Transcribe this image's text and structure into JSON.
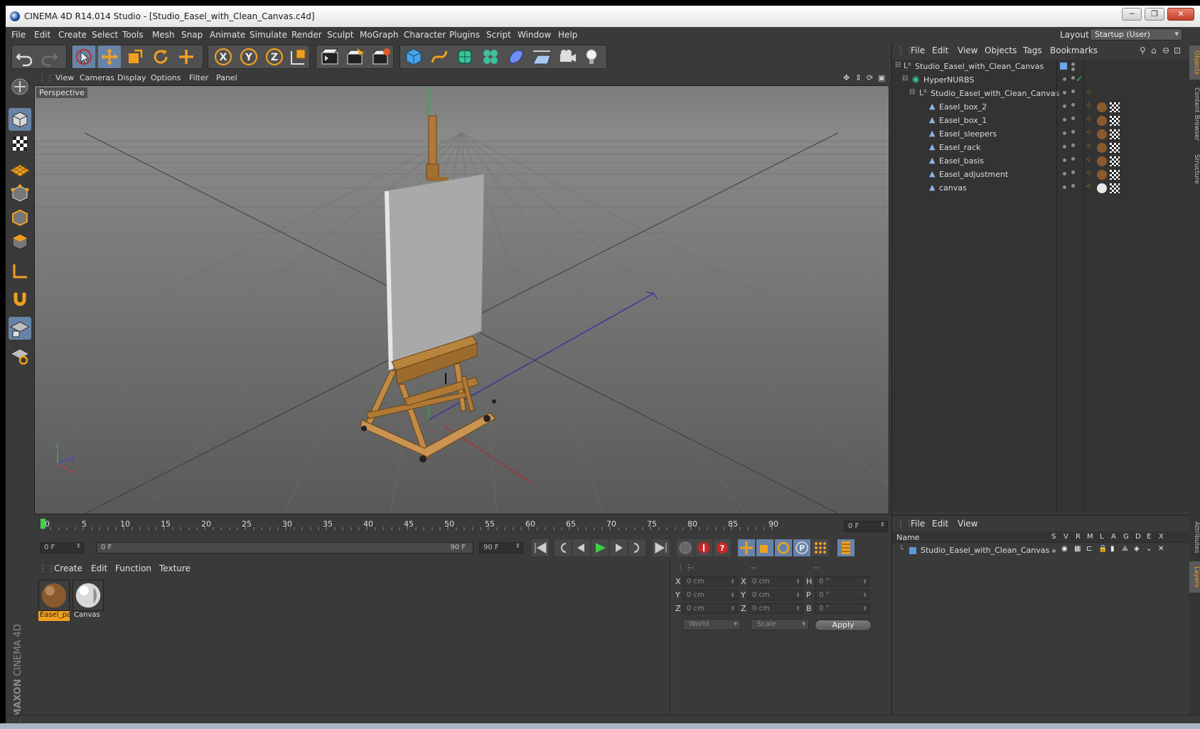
{
  "window": {
    "title": "CINEMA 4D R14.014 Studio - [Studio_Easel_with_Clean_Canvas.c4d]",
    "min": "─",
    "max": "❐",
    "close": "✕"
  },
  "menubar": {
    "items": [
      "File",
      "Edit",
      "Create",
      "Select",
      "Tools",
      "Mesh",
      "Snap",
      "Animate",
      "Simulate",
      "Render",
      "Sculpt",
      "MoGraph",
      "Character",
      "Plugins",
      "Script",
      "Window",
      "Help"
    ],
    "layout_label": "Layout:",
    "layout_value": "Startup (User)"
  },
  "viewport": {
    "menu": [
      "View",
      "Cameras",
      "Display",
      "Options",
      "Filter",
      "Panel"
    ],
    "label": "Perspective",
    "axis_y": "Y",
    "axis_x": "X",
    "axis_z": "Z"
  },
  "timeline": {
    "ticks": [
      "0",
      "5",
      "10",
      "15",
      "20",
      "25",
      "30",
      "35",
      "40",
      "45",
      "50",
      "55",
      "60",
      "65",
      "70",
      "75",
      "80",
      "85",
      "90"
    ],
    "current_frame": "0 F",
    "start_frame": "0 F",
    "range_start": "0 F",
    "range_end": "90 F",
    "end_frame": "90 F"
  },
  "material_manager": {
    "menu": [
      "Create",
      "Edit",
      "Function",
      "Texture"
    ],
    "materials": [
      {
        "label": "Easel_pa",
        "selected": true
      },
      {
        "label": "Canvas",
        "selected": false
      }
    ]
  },
  "coordinates": {
    "col_headers": [
      "--",
      "--",
      "--"
    ],
    "rows": [
      {
        "pos_label": "X",
        "pos_value": "0 cm",
        "size_label": "X",
        "size_value": "0 cm",
        "rot_label": "H",
        "rot_value": "0 °"
      },
      {
        "pos_label": "Y",
        "pos_value": "0 cm",
        "size_label": "Y",
        "size_value": "0 cm",
        "rot_label": "P",
        "rot_value": "0 °"
      },
      {
        "pos_label": "Z",
        "pos_value": "0 cm",
        "size_label": "Z",
        "size_value": "0 cm",
        "rot_label": "B",
        "rot_value": "0 °"
      }
    ],
    "space": "World",
    "mode": "Scale",
    "apply": "Apply"
  },
  "object_manager": {
    "menu": [
      "File",
      "Edit",
      "View",
      "Objects",
      "Tags",
      "Bookmarks"
    ],
    "objects": [
      {
        "name": "Studio_Easel_with_Clean_Canvas",
        "type": "null",
        "indent": 0
      },
      {
        "name": "HyperNURBS",
        "type": "hypernurbs",
        "indent": 1
      },
      {
        "name": "Studio_Easel_with_Clean_Canvas",
        "type": "null",
        "indent": 2
      },
      {
        "name": "Easel_box_2",
        "type": "mesh",
        "indent": 3
      },
      {
        "name": "Easel_box_1",
        "type": "mesh",
        "indent": 3
      },
      {
        "name": "Easel_sleepers",
        "type": "mesh",
        "indent": 3
      },
      {
        "name": "Easel_rack",
        "type": "mesh",
        "indent": 3
      },
      {
        "name": "Easel_basis",
        "type": "mesh",
        "indent": 3
      },
      {
        "name": "Easel_adjustment",
        "type": "mesh",
        "indent": 3
      },
      {
        "name": "canvas",
        "type": "mesh",
        "indent": 3
      }
    ]
  },
  "side_tabs": [
    "Objects",
    "Content Browser",
    "Structure",
    "Attributes",
    "Layers"
  ],
  "layer_manager": {
    "menu": [
      "File",
      "Edit",
      "View"
    ],
    "columns": [
      "Name",
      "S",
      "V",
      "R",
      "M",
      "L",
      "A",
      "G",
      "D",
      "E",
      "X"
    ],
    "layers": [
      {
        "name": "Studio_Easel_with_Clean_Canvas",
        "color": "#5b9bd5"
      }
    ]
  },
  "branding": {
    "maxon": "MAXON",
    "product": "CINEMA 4D"
  },
  "colors": {
    "accent": "#f0a020",
    "selection": "#6784a8",
    "bg": "#3a3a3a"
  }
}
